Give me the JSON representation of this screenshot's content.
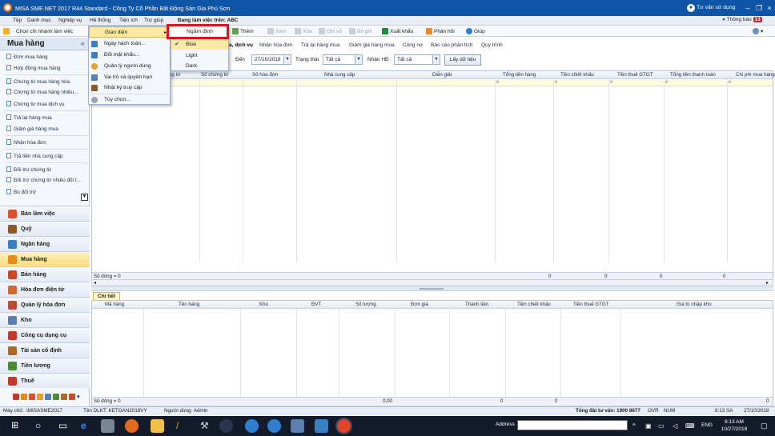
{
  "app": {
    "title": "MISA SME.NET 2017 R44 Standard - Công Ty Cổ Phần Bất Động Sản Gia Phú Sơn",
    "consult": "Tư vấn sử dụng",
    "company_label": "Đang làm việc trên: ABC",
    "notify_label": "Thông báo",
    "notify_count": "13"
  },
  "menubar": [
    "Tệp",
    "Danh mục",
    "Nghiệp vụ",
    "Hệ thống",
    "Tiện ích",
    "Trợ giúp"
  ],
  "toolbar": {
    "branch": "Chọn chi nhánh làm việc",
    "add": "Thêm",
    "view": "Xem",
    "delete": "Xóa",
    "post": "Ghi sổ",
    "unpost": "Bỏ ghi",
    "export": "Xuất khẩu",
    "feedback": "Phản hồi",
    "help": "Giúp"
  },
  "sidebar": {
    "title": "Mua hàng",
    "items": [
      "Đơn mua hàng",
      "Hợp đồng mua hàng",
      "Chứng từ mua hàng hóa",
      "Chứng từ mua hàng nhiều...",
      "Chứng từ mua dịch vụ",
      "Trả lại hàng mua",
      "Giảm giá hàng mua",
      "Nhận hóa đơn",
      "Trả tiền nhà cung cấp",
      "Đối trừ chứng từ",
      "Đối trừ chứng từ nhiều đối t...",
      "Bù đối trừ"
    ],
    "categories": [
      "Bàn làm việc",
      "Quỹ",
      "Ngân hàng",
      "Mua hàng",
      "Bán hàng",
      "Hóa đơn điện tử",
      "Quản lý hóa đơn",
      "Kho",
      "Công cụ dụng cụ",
      "Tài sản cố định",
      "Tiền lương",
      "Thuế"
    ]
  },
  "system_menu": {
    "items": [
      "Giao diện",
      "Ngày hạch toán...",
      "Đổi mật khẩu...",
      "Quản lý người dùng",
      "Vai trò và quyền hạn",
      "Nhật ký truy cập",
      "Tùy chọn..."
    ]
  },
  "theme_menu": {
    "items": [
      "Ngầm định",
      "Blue",
      "Light",
      "Dark"
    ],
    "checked": "Blue",
    "highlighted": "Ngầm định"
  },
  "tabs": [
    "a, dịch vụ",
    "Nhận hóa đơn",
    "Trả lại hàng mua",
    "Giảm giá hàng mua",
    "Công nợ",
    "Báo cáo phân tích",
    "Quy trình"
  ],
  "filter": {
    "to_label": "Đến",
    "to_value": "27/10/2018",
    "status_label": "Trạng thái",
    "status_value": "Tất cả",
    "receive_label": "Nhận HĐ",
    "receive_value": "Tất cả",
    "get_data": "Lấy dữ liệu"
  },
  "grid1": {
    "columns": [
      "ng từ",
      "Số chứng từ",
      "Số hóa đơn",
      "Nhà cung cấp",
      "Diễn giải",
      "Tổng tiền hàng",
      "Tiền chiết khấu",
      "Tiền thuế GTGT",
      "Tổng tiền thanh toán",
      "Chi phí mua hàng"
    ],
    "row_count": "Số dòng = 0",
    "totals": [
      "0",
      "0",
      "0",
      "0"
    ]
  },
  "detail": {
    "tab": "Chi tiết",
    "columns": [
      "Mã hàng",
      "Tên hàng",
      "Kho",
      "ĐVT",
      "Số lượng",
      "Đơn giá",
      "Thành tiền",
      "Tiền chiết khấu",
      "Tiền thuế GTGT",
      "Giá trị nhập kho"
    ],
    "row_count": "Số dòng = 0",
    "totals": [
      "0,00",
      "0",
      "0",
      "0"
    ]
  },
  "statusbar": {
    "server": "Máy chủ: .\\MISASME2017",
    "db": "Tên DLKT: KETOAN2018VY",
    "user": "Người dùng: Admin",
    "hotline": "Tổng đài tư vấn: 1900 8677",
    "ovr": "OVR",
    "num": "NUM",
    "time": "8:13 SA",
    "date": "27/10/2018"
  },
  "taskbar": {
    "address_label": "Address",
    "lang": "ENG",
    "time": "8:13 AM",
    "date": "10/27/2018"
  },
  "colors": {
    "titlebar": "#0e55a8",
    "highlight_box": "#e0131c",
    "selected_category": "#ffdc7e"
  }
}
